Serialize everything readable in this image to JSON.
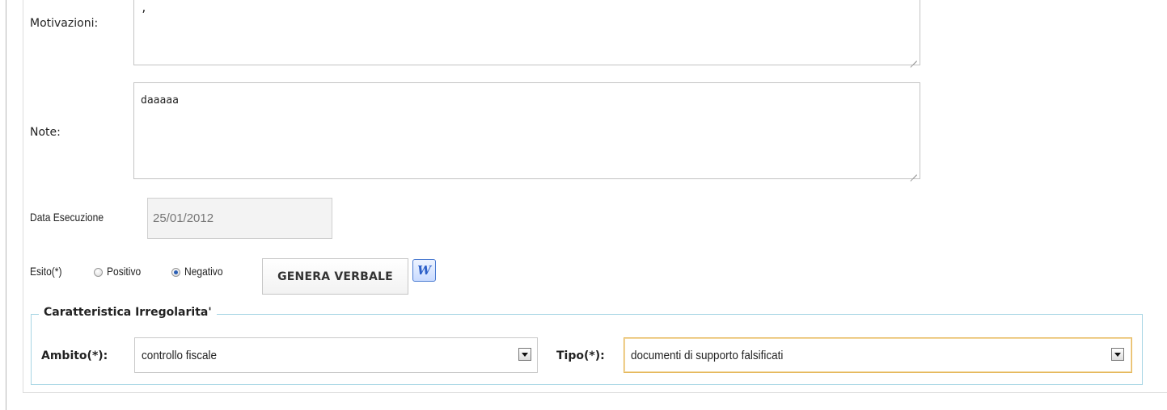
{
  "motivazioni": {
    "label": "Motivazioni:",
    "value": ","
  },
  "note": {
    "label": "Note:",
    "value": "daaaaa"
  },
  "data_esecuzione": {
    "label": "Data Esecuzione",
    "value": "25/01/2012"
  },
  "esito": {
    "label": "Esito(*)",
    "options": [
      {
        "label": "Positivo",
        "selected": false
      },
      {
        "label": "Negativo",
        "selected": true
      }
    ],
    "button_label": "GENERA VERBALE",
    "icon": "word-document-icon"
  },
  "irregolarita": {
    "legend": "Caratteristica Irregolarita'",
    "ambito_label": "Ambito(*):",
    "ambito_value": "controllo fiscale",
    "tipo_label": "Tipo(*):",
    "tipo_value": "documenti di supporto falsificati"
  },
  "colors": {
    "fieldset_border": "#a8d6e4",
    "focus_border": "#e5b75a",
    "radio_selected": "#2b5fb4"
  }
}
